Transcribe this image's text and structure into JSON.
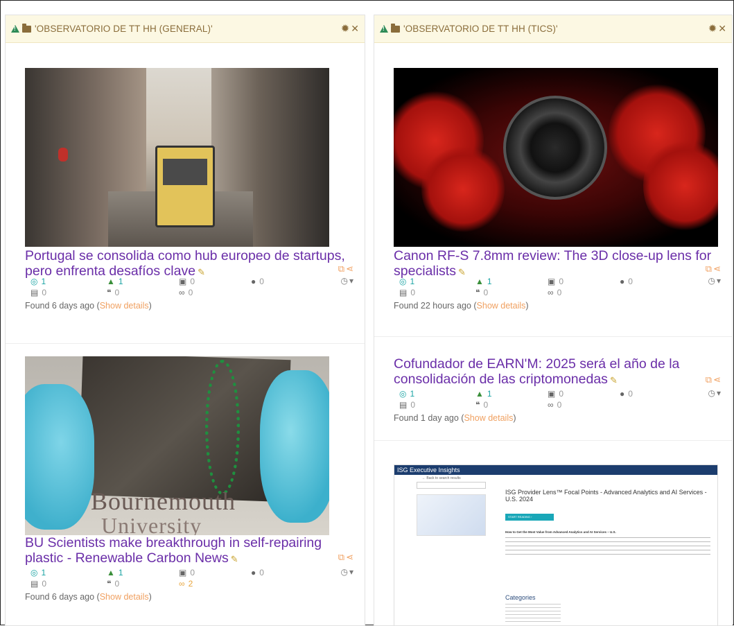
{
  "panels": [
    {
      "title": "'OBSERVATORIO DE TT HH (GENERAL)'",
      "articles": [
        {
          "title": "Portugal se consolida como hub europeo de startups, pero enfrenta desafíos clave",
          "stats": {
            "views": "1",
            "likes": "1",
            "photos": "0",
            "targets": "0",
            "docs": "0",
            "comments": "0",
            "links": "0"
          },
          "found_prefix": "Found 6 days ago (",
          "show_details": "Show details",
          "found_suffix": ")"
        },
        {
          "title": "BU Scientists make breakthrough in self-repairing plastic - Renewable Carbon News",
          "stats": {
            "views": "1",
            "likes": "1",
            "photos": "0",
            "targets": "0",
            "docs": "0",
            "comments": "0",
            "links": "2"
          },
          "found_prefix": "Found 6 days ago (",
          "show_details": "Show details",
          "found_suffix": ")",
          "image_text_1": "Bournemouth",
          "image_text_2": "University"
        }
      ]
    },
    {
      "title": "'OBSERVATORIO DE TT HH (TICS)'",
      "articles": [
        {
          "title": "Canon RF-S 7.8mm review: The 3D close-up lens for specialists",
          "stats": {
            "views": "1",
            "likes": "1",
            "photos": "0",
            "targets": "0",
            "docs": "0",
            "comments": "0",
            "links": "0"
          },
          "found_prefix": "Found 22 hours ago (",
          "show_details": "Show details",
          "found_suffix": ")"
        },
        {
          "title": "Cofundador de EARN'M: 2025 será el año de la consolidación de las criptomonedas",
          "stats": {
            "views": "1",
            "likes": "1",
            "photos": "0",
            "targets": "0",
            "docs": "0",
            "comments": "0",
            "links": "0"
          },
          "found_prefix": "Found 1 day ago (",
          "show_details": "Show details",
          "found_suffix": ")"
        },
        {
          "doc": {
            "bar": "ISG Executive Insights",
            "back": "← Back to search results",
            "heading": "ISG Provider Lens™ Focal Points - Advanced Analytics and AI Services - U.S. 2024",
            "button": "START READING ›",
            "subheading": "How to Get the Most Value from Advanced Analytics and AI Services – U.S.",
            "categories": "Categories"
          }
        }
      ]
    }
  ],
  "icons": {
    "warning": "warning-icon",
    "folder": "folder-icon",
    "gear": "gear-icon",
    "close": "close-icon",
    "pencil": "pencil-icon",
    "external": "external-link-icon",
    "share": "share-icon",
    "clock": "clock-icon",
    "thumbs_down": "thumbs-down-icon"
  },
  "colors": {
    "header_bg": "#fcf8e3",
    "header_text": "#8a6d3b",
    "title_link": "#6a2ea8",
    "show_details": "#f0a060",
    "teal": "#1aa3a3",
    "green": "#3a8f3a"
  }
}
